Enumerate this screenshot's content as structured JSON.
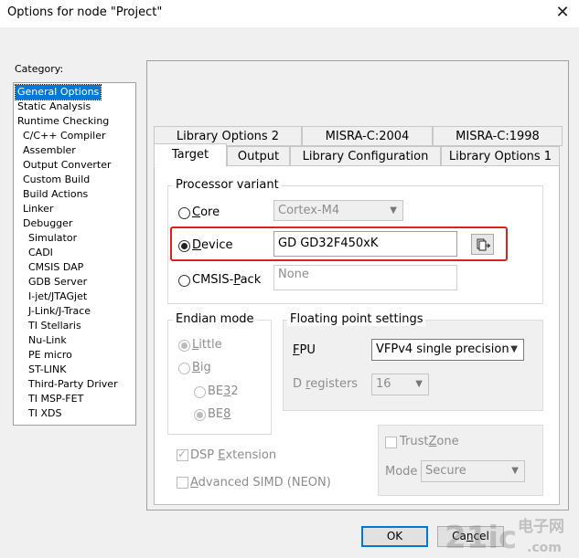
{
  "window": {
    "title": "Options for node \"Project\"",
    "close_glyph": "✕"
  },
  "category": {
    "label": "Category:",
    "items": [
      {
        "label": "General Options",
        "level": 0,
        "selected": true
      },
      {
        "label": "Static Analysis",
        "level": 0
      },
      {
        "label": "Runtime Checking",
        "level": 0
      },
      {
        "label": "C/C++ Compiler",
        "level": 1
      },
      {
        "label": "Assembler",
        "level": 1
      },
      {
        "label": "Output Converter",
        "level": 1
      },
      {
        "label": "Custom Build",
        "level": 1
      },
      {
        "label": "Build Actions",
        "level": 1
      },
      {
        "label": "Linker",
        "level": 1
      },
      {
        "label": "Debugger",
        "level": 1
      },
      {
        "label": "Simulator",
        "level": 2
      },
      {
        "label": "CADI",
        "level": 2
      },
      {
        "label": "CMSIS DAP",
        "level": 2
      },
      {
        "label": "GDB Server",
        "level": 2
      },
      {
        "label": "I-jet/JTAGjet",
        "level": 2
      },
      {
        "label": "J-Link/J-Trace",
        "level": 2
      },
      {
        "label": "TI Stellaris",
        "level": 2
      },
      {
        "label": "Nu-Link",
        "level": 2
      },
      {
        "label": "PE micro",
        "level": 2
      },
      {
        "label": "ST-LINK",
        "level": 2
      },
      {
        "label": "Third-Party Driver",
        "level": 2
      },
      {
        "label": "TI MSP-FET",
        "level": 2
      },
      {
        "label": "TI XDS",
        "level": 2
      }
    ]
  },
  "tabs": {
    "row_back": [
      "Library Options 2",
      "MISRA-C:2004",
      "MISRA-C:1998"
    ],
    "row_front": [
      "Target",
      "Output",
      "Library Configuration",
      "Library Options 1"
    ],
    "active": "Target"
  },
  "processor_variant": {
    "label": "Processor variant",
    "core": {
      "a": "C",
      "b": "ore",
      "selected": false,
      "value": "Cortex-M4"
    },
    "device": {
      "a": "D",
      "b": "evice",
      "selected": true,
      "value": "GD GD32F450xK"
    },
    "cmsis_pack": {
      "a": "CMSIS-",
      "b": "P",
      "c": "ack",
      "selected": false,
      "value": "None"
    }
  },
  "endian_mode": {
    "label": "Endian mode",
    "little": {
      "a": "L",
      "b": "ittle",
      "selected": true
    },
    "big": {
      "a": "B",
      "b": "ig",
      "selected": false
    },
    "be32": {
      "a": "BE",
      "b": "3",
      "c": "2",
      "selected": false
    },
    "be8": {
      "a": "BE",
      "b": "8",
      "selected": true
    }
  },
  "floating_point": {
    "label": "Floating point settings",
    "fpu": {
      "a": "F",
      "b": "PU",
      "value": "VFPv4 single precision"
    },
    "d_registers": {
      "a": "D ",
      "b": "r",
      "c": "egisters",
      "value": "16"
    }
  },
  "dsp_extension": {
    "a": "DSP ",
    "b": "E",
    "c": "xtension",
    "checked": true
  },
  "advanced_simd": {
    "a": "A",
    "b": "dvanced SIMD (NEON)",
    "checked": false
  },
  "trustzone": {
    "a": "Trust",
    "b": "Z",
    "c": "one",
    "checked": false,
    "mode_label": "Mode",
    "mode_value": "Secure"
  },
  "buttons": {
    "ok": "OK",
    "cancel_a": "Ca",
    "cancel_b": "n",
    "cancel_c": "cel"
  },
  "watermark": {
    "top": "电子网",
    "bottom": ".com",
    "brand": "21ic"
  }
}
